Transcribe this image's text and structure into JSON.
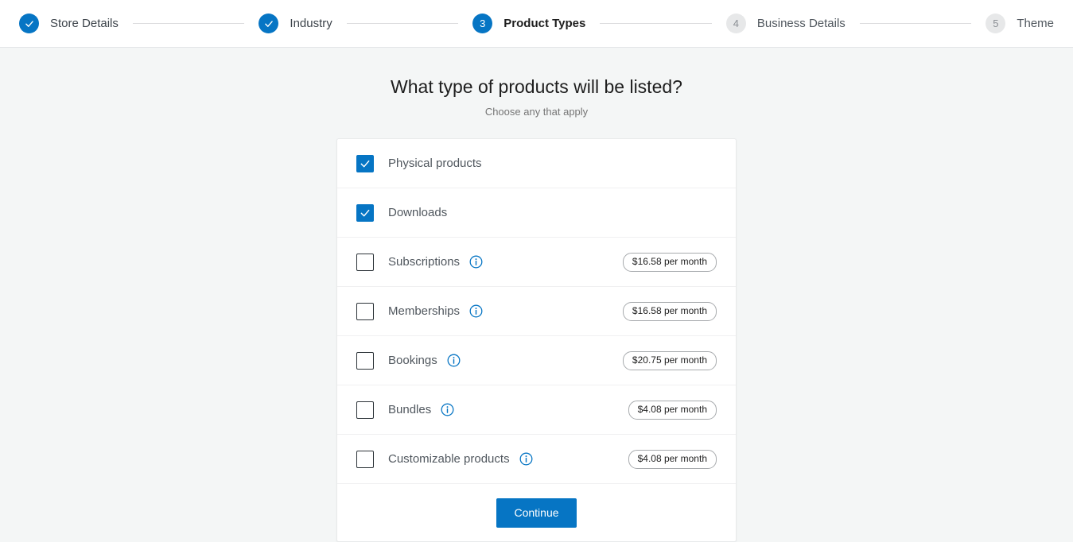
{
  "stepper": {
    "steps": [
      {
        "label": "Store Details",
        "state": "done",
        "indicator": "check-icon"
      },
      {
        "label": "Industry",
        "state": "done",
        "indicator": "check-icon"
      },
      {
        "label": "Product Types",
        "state": "active",
        "indicator": "3"
      },
      {
        "label": "Business Details",
        "state": "todo",
        "indicator": "4"
      },
      {
        "label": "Theme",
        "state": "todo",
        "indicator": "5"
      }
    ]
  },
  "main": {
    "title": "What type of products will be listed?",
    "subtitle": "Choose any that apply",
    "product_types": [
      {
        "label": "Physical products",
        "checked": true,
        "info": false,
        "price": null
      },
      {
        "label": "Downloads",
        "checked": true,
        "info": false,
        "price": null
      },
      {
        "label": "Subscriptions",
        "checked": false,
        "info": true,
        "price": "$16.58 per month"
      },
      {
        "label": "Memberships",
        "checked": false,
        "info": true,
        "price": "$16.58 per month"
      },
      {
        "label": "Bookings",
        "checked": false,
        "info": true,
        "price": "$20.75 per month"
      },
      {
        "label": "Bundles",
        "checked": false,
        "info": true,
        "price": "$4.08 per month"
      },
      {
        "label": "Customizable products",
        "checked": false,
        "info": true,
        "price": "$4.08 per month"
      }
    ],
    "continue_label": "Continue"
  },
  "colors": {
    "accent": "#0675c4",
    "page_background": "#f4f6f6",
    "card_background": "#ffffff",
    "muted_text": "#757575"
  }
}
